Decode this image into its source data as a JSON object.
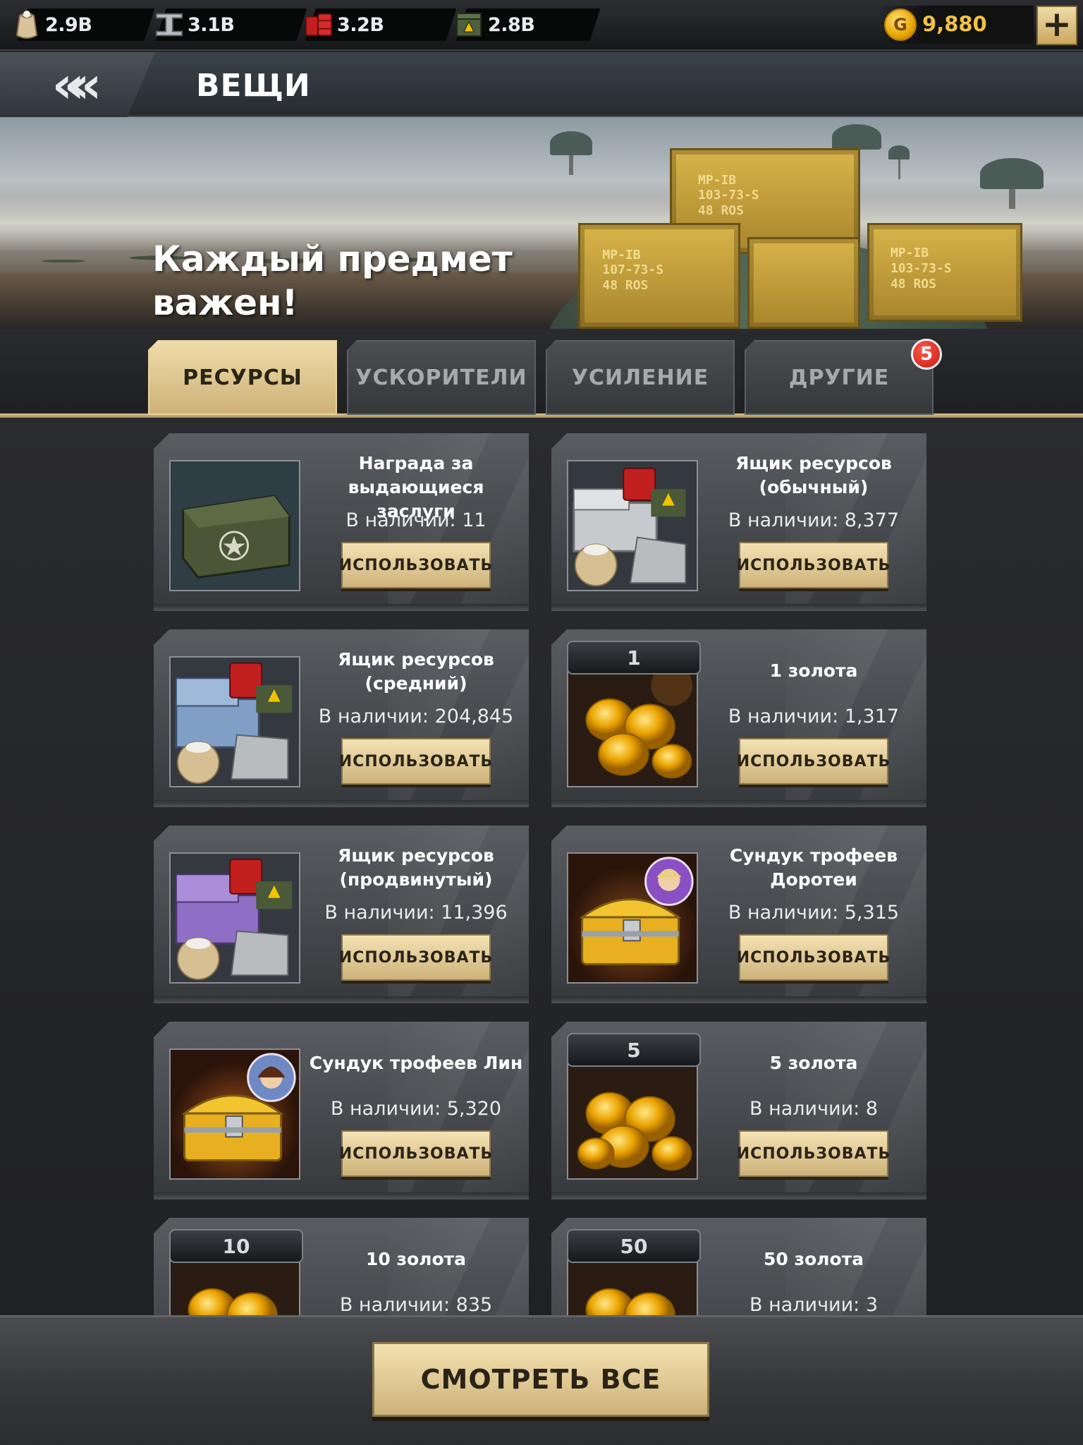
{
  "resources": [
    {
      "name": "food-icon",
      "value": "2.9B"
    },
    {
      "name": "steel-icon",
      "value": "3.1B"
    },
    {
      "name": "oil-icon",
      "value": "3.2B"
    },
    {
      "name": "ammo-icon",
      "value": "2.8B"
    }
  ],
  "gold": {
    "value": "9,880",
    "coin_glyph": "G"
  },
  "header": {
    "title": "ВЕЩИ",
    "back_glyph": "«"
  },
  "banner": {
    "slogan_line1": "Каждый предмет",
    "slogan_line2": "важен!",
    "stencil_1": "MP-IB\n103-73-S\n48 ROS",
    "stencil_2": "MP-IB\n107-73-S\n48 ROS",
    "stencil_3": "MP-IB\n103-73-S\n48 ROS"
  },
  "tabs": [
    {
      "label": "РЕСУРСЫ",
      "active": true
    },
    {
      "label": "УСКОРИТЕЛИ",
      "active": false
    },
    {
      "label": "УСИЛЕНИЕ",
      "active": false
    },
    {
      "label": "ДРУГИЕ",
      "active": false
    }
  ],
  "tab_badge": "5",
  "use_label": "ИСПОЛЬЗОВАТЬ",
  "items": [
    {
      "name_line1": "Награда за",
      "name_line2": "выдающиеся заслуги",
      "count": "В наличии: 11",
      "thumb": "military-crate-icon"
    },
    {
      "name_line1": "Ящик ресурсов",
      "name_line2": "(обычный)",
      "count": "В наличии: 8,377",
      "thumb": "resource-crate-common-icon"
    },
    {
      "name_line1": "Ящик ресурсов",
      "name_line2": "(средний)",
      "count": "В наличии: 204,845",
      "thumb": "resource-crate-medium-icon"
    },
    {
      "name_line1": "1 золота",
      "name_line2": "",
      "count": "В наличии: 1,317",
      "tag": "1",
      "thumb": "gold-coins-icon"
    },
    {
      "name_line1": "Ящик ресурсов",
      "name_line2": "(продвинутый)",
      "count": "В наличии: 11,396",
      "thumb": "resource-crate-advanced-icon"
    },
    {
      "name_line1": "Сундук трофеев",
      "name_line2": "Доротеи",
      "count": "В наличии: 5,315",
      "thumb": "trophy-chest-dorothea-icon"
    },
    {
      "name_line1": "Сундук трофеев Лин",
      "name_line2": "",
      "count": "В наличии: 5,320",
      "thumb": "trophy-chest-lin-icon"
    },
    {
      "name_line1": "5 золота",
      "name_line2": "",
      "count": "В наличии: 8",
      "tag": "5",
      "thumb": "gold-coins-icon"
    },
    {
      "name_line1": "10 золота",
      "name_line2": "",
      "count": "В наличии: 835",
      "tag": "10",
      "thumb": "gold-coins-icon"
    },
    {
      "name_line1": "50 золота",
      "name_line2": "",
      "count": "В наличии: 3",
      "tag": "50",
      "thumb": "gold-coins-icon"
    }
  ],
  "see_all_label": "СМОТРЕТЬ ВСЕ",
  "colors": {
    "accent_gold": "#cdb277",
    "active_tab": "#f0dcaa",
    "gold_text": "#f2c243",
    "badge_red": "#c41a12"
  }
}
